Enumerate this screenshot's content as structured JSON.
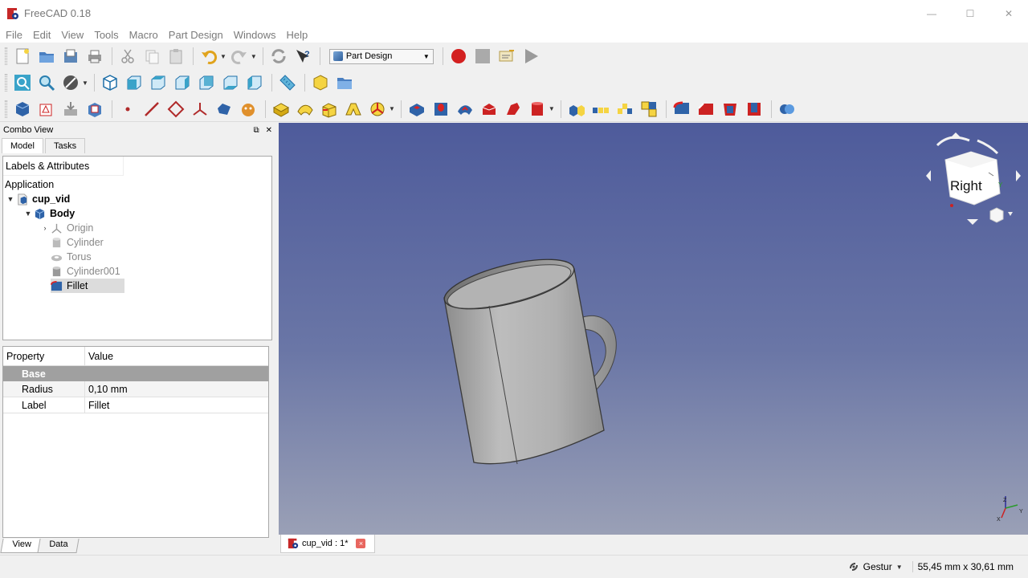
{
  "window": {
    "title": "FreeCAD 0.18",
    "minimize_glyph": "—",
    "maximize_glyph": "☐",
    "close_glyph": "✕"
  },
  "menu": [
    "File",
    "Edit",
    "View",
    "Tools",
    "Macro",
    "Part Design",
    "Windows",
    "Help"
  ],
  "toolbar": {
    "workbench": "Part Design"
  },
  "combo_view": {
    "title": "Combo View",
    "tabs": [
      "Model",
      "Tasks"
    ],
    "active_tab": "Model",
    "tree_header": "Labels & Attributes",
    "tree": [
      {
        "label": "Application",
        "icon": "none"
      },
      {
        "label": "cup_vid",
        "icon": "document-icon",
        "bold": true,
        "expanded": true
      },
      {
        "label": "Body",
        "icon": "body-icon",
        "bold": true,
        "expanded": true
      },
      {
        "label": "Origin",
        "icon": "origin-icon",
        "collapsed": true,
        "hidden": true
      },
      {
        "label": "Cylinder",
        "icon": "cylinder-icon",
        "hidden": true
      },
      {
        "label": "Torus",
        "icon": "torus-icon",
        "hidden": true
      },
      {
        "label": "Cylinder001",
        "icon": "cylinder-icon",
        "hidden": true
      },
      {
        "label": "Fillet",
        "icon": "fillet-icon",
        "selected": true
      }
    ],
    "properties": {
      "col_property": "Property",
      "col_value": "Value",
      "group": "Base",
      "rows": [
        {
          "key": "Radius",
          "value": "0,10 mm"
        },
        {
          "key": "Label",
          "value": "Fillet"
        }
      ]
    },
    "bottom_tabs": [
      "View",
      "Data"
    ],
    "active_bottom_tab": "View"
  },
  "view3d": {
    "navcube_face": "Right",
    "axis_labels": [
      "X",
      "Y",
      "Z"
    ]
  },
  "doc_tab": {
    "label": "cup_vid : 1*",
    "close_glyph": "×"
  },
  "status": {
    "navigation_style": "Gestur",
    "dimensions": "55,45 mm x 30,61 mm"
  }
}
